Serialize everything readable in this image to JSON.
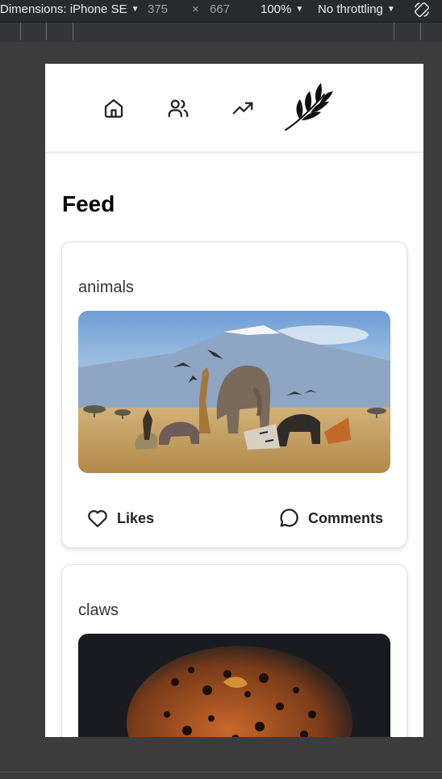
{
  "devtools": {
    "dimensions_label": "Dimensions: iPhone SE",
    "width": "375",
    "times": "×",
    "height": "667",
    "zoom": "100%",
    "throttling": "No throttling"
  },
  "nav": {
    "icons": [
      "home-icon",
      "users-icon",
      "trending-icon",
      "leaf-logo"
    ]
  },
  "feed": {
    "title": "Feed",
    "posts": [
      {
        "title": "animals",
        "likes_label": "Likes",
        "comments_label": "Comments"
      },
      {
        "title": "claws"
      }
    ]
  },
  "colors": {
    "text_dark": "#222222",
    "border": "#e2e2e2",
    "devtools_bg": "#292a2d"
  }
}
